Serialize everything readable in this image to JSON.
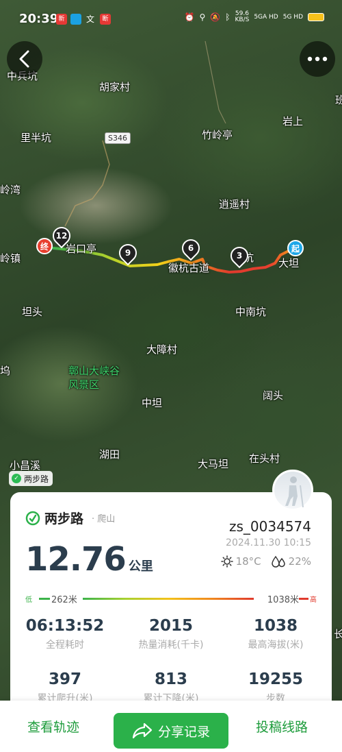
{
  "status_bar": {
    "time": "20:39",
    "app_icons": [
      "新",
      "文",
      "断"
    ],
    "net_speed_value": "59.6",
    "net_speed_unit": "KB/S",
    "net_1": "5GA HD",
    "net_2": "5G HD"
  },
  "map": {
    "labels": {
      "zhongbingkeng": "中兵坑",
      "hujiacun": "胡家村",
      "lipingkeng": "里半坑",
      "zhulingting": "竹岭亭",
      "yanshang": "岩上",
      "lingwan": "岭湾",
      "xiaoyaocun": "逍遥村",
      "kouting": "岩口亭",
      "huihanggudao": "徽杭古道",
      "keng": "坑",
      "dadan": "大坦",
      "lingzhen": "岭镇",
      "tantou": "坦头",
      "zhongnankeng": "中南坑",
      "dazhangcun": "大障村",
      "wu": "坞",
      "scenic": "鄣山大峡谷风景区",
      "zhongtan": "中坦",
      "kuotou": "阔头",
      "xiaochangxi": "小昌溪",
      "hutian": "湖田",
      "damatan": "大马坦",
      "zaishancun": "在头村",
      "edge_right_1": "班",
      "edge_right_2": "长"
    },
    "road_badge": "S346",
    "markers": {
      "end": "终",
      "start": "起",
      "pin_12": "12",
      "pin_9": "9",
      "pin_6": "6",
      "pin_3": "3"
    },
    "app_tag": "两步路"
  },
  "card": {
    "brand": "两步路",
    "activity": "· 爬山",
    "distance_value": "12.76",
    "distance_unit": "公里",
    "user_id": "zs_0034574",
    "datetime": "2024.11.30 10:15",
    "temperature": "18°C",
    "humidity": "22%",
    "elevation": {
      "low_label": "低",
      "high_label": "高",
      "min": "262米",
      "max": "1038米"
    },
    "stats": [
      {
        "value": "06:13:52",
        "label": "全程耗时"
      },
      {
        "value": "2015",
        "label": "热量消耗(千卡)"
      },
      {
        "value": "1038",
        "label": "最高海拔(米)"
      },
      {
        "value": "397",
        "label": "累计爬升(米)"
      },
      {
        "value": "813",
        "label": "累计下降(米)"
      },
      {
        "value": "19255",
        "label": "步数"
      }
    ]
  },
  "bottom_bar": {
    "view_track": "查看轨迹",
    "share": "分享记录",
    "submit_route": "投稿线路"
  },
  "colors": {
    "accent_green": "#2bb14a",
    "end_red": "#e8402f",
    "start_blue": "#1ea7e8"
  }
}
